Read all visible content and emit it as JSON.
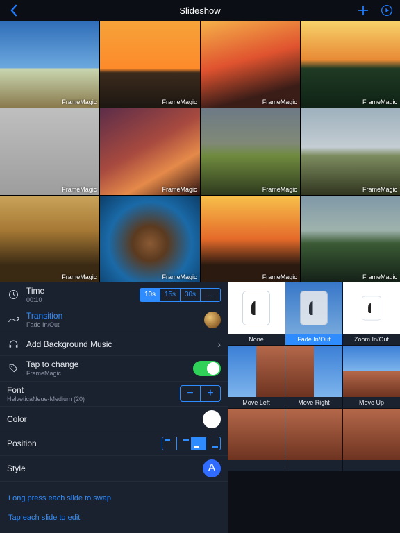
{
  "header": {
    "title": "Slideshow"
  },
  "watermark": "FrameMagic",
  "panel": {
    "time": {
      "label": "Time",
      "value": "00:10"
    },
    "time_segments": [
      "10s",
      "15s",
      "30s",
      "..."
    ],
    "transition": {
      "label": "Transition",
      "value": "Fade In/Out"
    },
    "music": {
      "label": "Add Background Music"
    },
    "tap": {
      "label": "Tap to change",
      "value": "FrameMagic"
    },
    "font": {
      "label": "Font",
      "value": "HelveticaNeue-Medium (20)"
    },
    "color": {
      "label": "Color"
    },
    "position": {
      "label": "Position"
    },
    "style": {
      "label": "Style",
      "glyph": "A"
    },
    "tips": {
      "swap": "Long press each slide to swap",
      "edit": "Tap each slide to edit"
    }
  },
  "transitions": {
    "none": "None",
    "fade": "Fade In/Out",
    "zoom": "Zoom In/Out",
    "moveleft": "Move Left",
    "moveright": "Move Right",
    "moveup": "Move Up"
  }
}
